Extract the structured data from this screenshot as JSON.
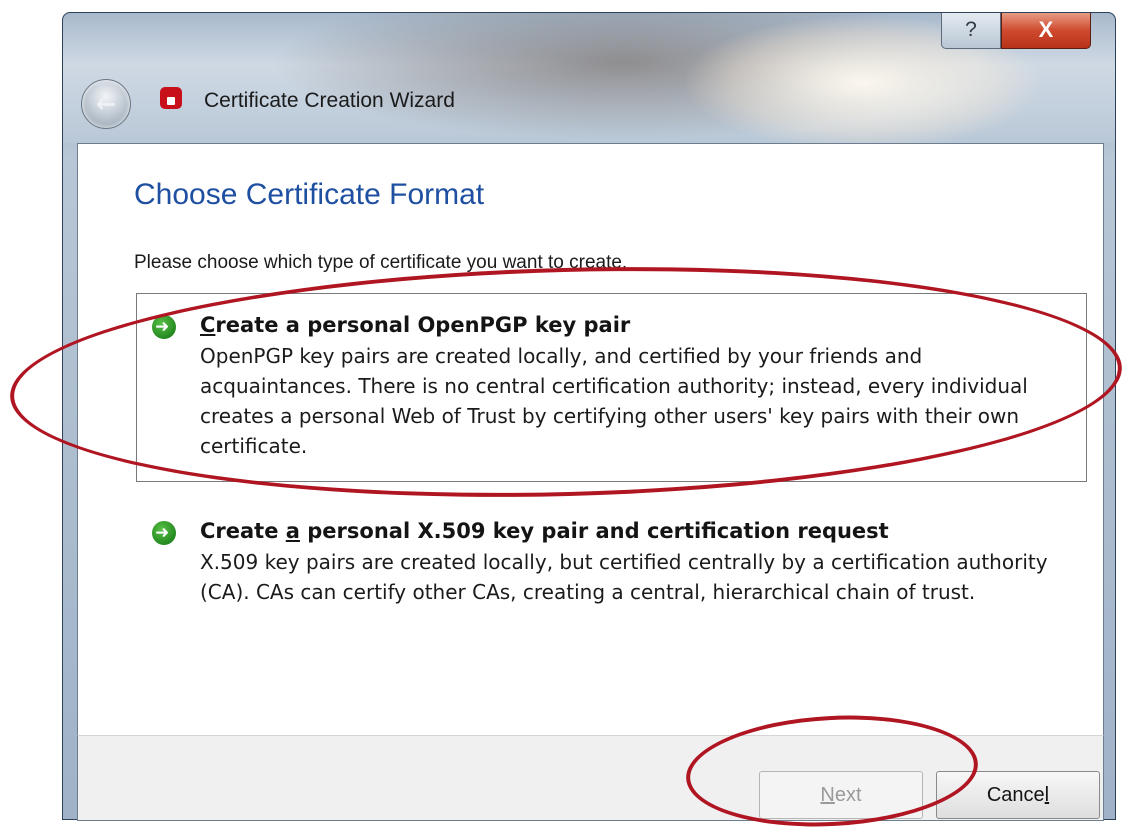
{
  "window": {
    "title": "Certificate Creation Wizard",
    "help_label": "?",
    "close_label": "X"
  },
  "page": {
    "heading": "Choose Certificate Format",
    "intro": "Please choose which type of certificate you want to create."
  },
  "options": [
    {
      "title_pre": "",
      "title_mnemonic": "C",
      "title_post": "reate a personal OpenPGP key pair",
      "description": "OpenPGP key pairs are created locally, and certified by your friends and acquaintances. There is no central certification authority; instead, every individual creates a personal Web of Trust by certifying other users' key pairs with their own certificate."
    },
    {
      "title_pre": "Create ",
      "title_mnemonic": "a",
      "title_post": " personal X.509 key pair and certification request",
      "description": "X.509 key pairs are created locally, but certified centrally by a certification authority (CA). CAs can certify other CAs, creating a central, hierarchical chain of trust."
    }
  ],
  "buttons": {
    "next_pre": "",
    "next_mnemonic": "N",
    "next_post": "ext",
    "next_enabled": false,
    "cancel_pre": "Cance",
    "cancel_mnemonic": "l",
    "cancel_post": ""
  },
  "colors": {
    "heading": "#1e4fa1",
    "annotation": "#b01522",
    "option_icon": "#2a9a2a"
  },
  "icons": {
    "back": "back-arrow-icon",
    "app": "certificate-app-icon",
    "option": "green-arrow-icon"
  }
}
